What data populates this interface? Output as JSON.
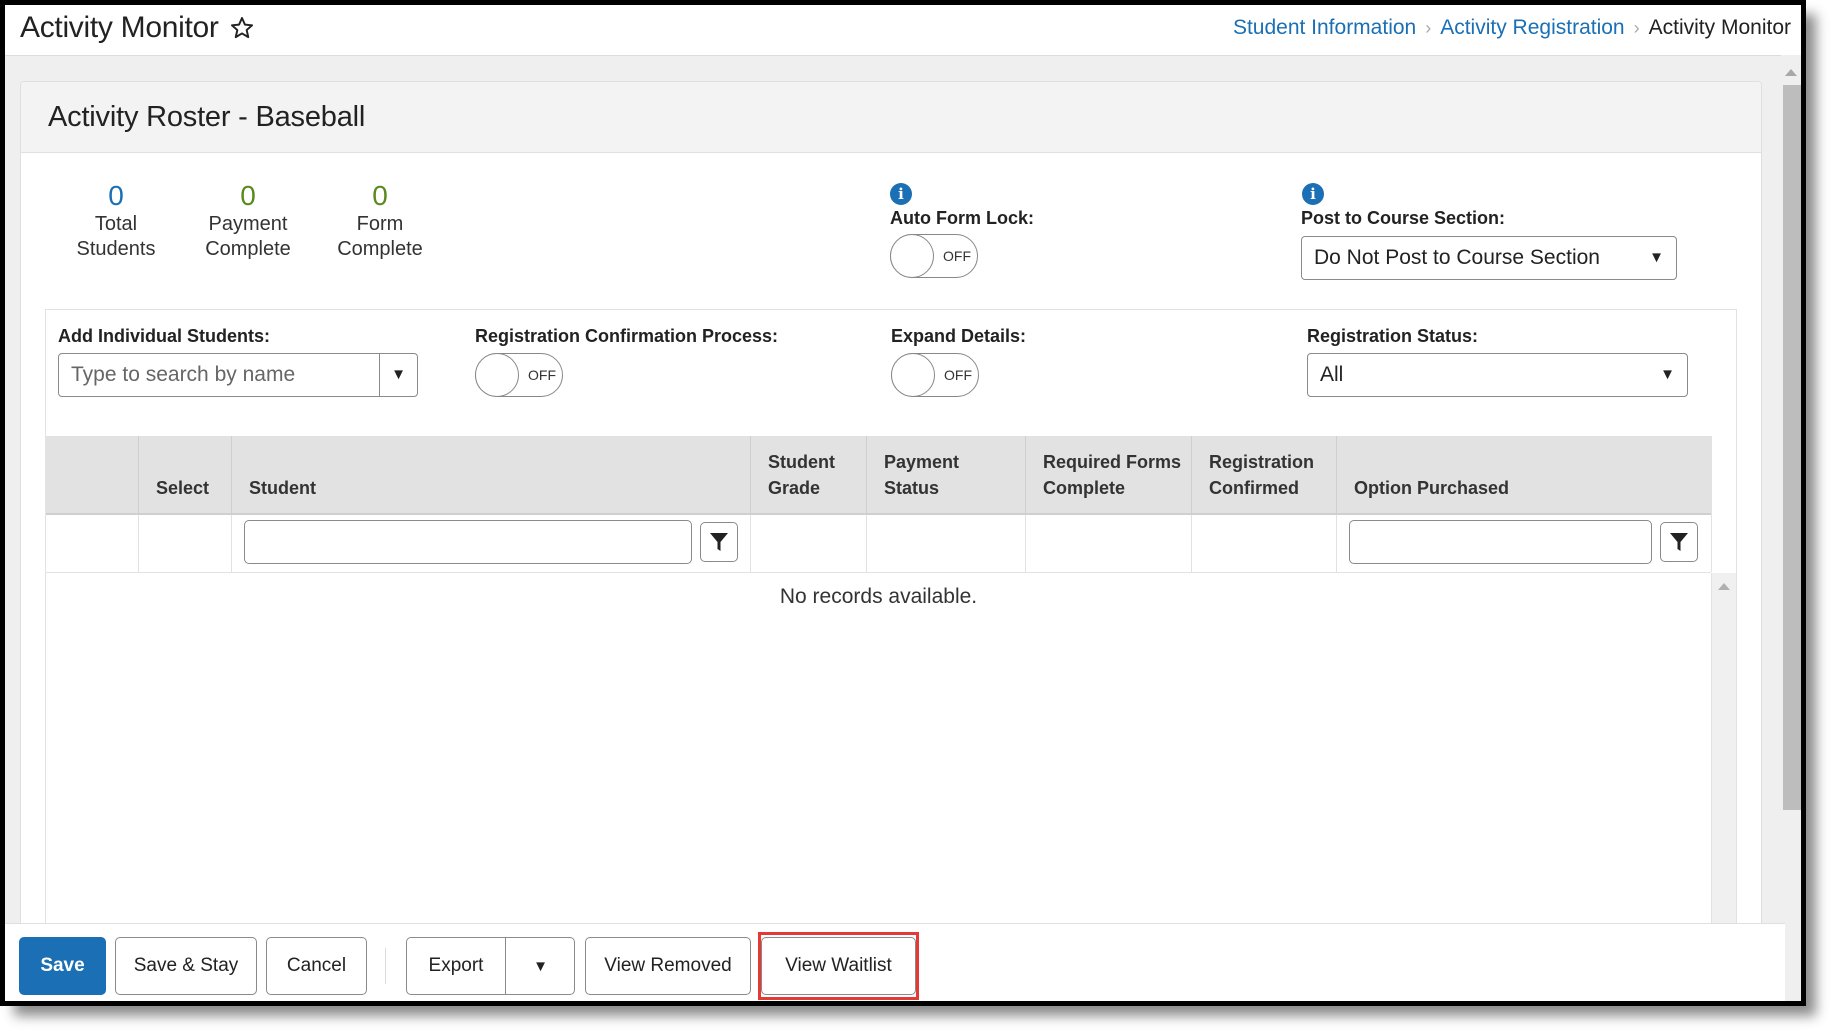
{
  "header": {
    "title": "Activity Monitor",
    "breadcrumb": [
      {
        "label": "Student Information",
        "link": true
      },
      {
        "label": "Activity Registration",
        "link": true
      },
      {
        "label": "Activity Monitor",
        "link": false
      }
    ],
    "breadcrumb_separator": "›"
  },
  "panel": {
    "title": "Activity Roster - Baseball",
    "stats": [
      {
        "value": "0",
        "label_line1": "Total",
        "label_line2": "Students",
        "color": "#1a6fb5"
      },
      {
        "value": "0",
        "label_line1": "Payment",
        "label_line2": "Complete",
        "color": "#5a8a1e"
      },
      {
        "value": "0",
        "label_line1": "Form",
        "label_line2": "Complete",
        "color": "#5a8a1e"
      }
    ],
    "auto_form_lock": {
      "label": "Auto Form Lock:",
      "state": "OFF",
      "info_icon": "i"
    },
    "post_to_course": {
      "label": "Post to Course Section:",
      "value": "Do Not Post to Course Section",
      "info_icon": "i"
    },
    "filters": {
      "add_students": {
        "label": "Add Individual Students:",
        "placeholder": "Type to search by name",
        "value": ""
      },
      "registration_confirmation": {
        "label": "Registration Confirmation Process:",
        "state": "OFF"
      },
      "expand_details": {
        "label": "Expand Details:",
        "state": "OFF"
      },
      "registration_status": {
        "label": "Registration Status:",
        "value": "All"
      }
    },
    "grid": {
      "columns": [
        {
          "line1": "",
          "line2": ""
        },
        {
          "line1": "",
          "line2": "Select"
        },
        {
          "line1": "",
          "line2": "Student"
        },
        {
          "line1": "Student",
          "line2": "Grade"
        },
        {
          "line1": "Payment",
          "line2": "Status"
        },
        {
          "line1": "Required Forms",
          "line2": "Complete"
        },
        {
          "line1": "Registration",
          "line2": "Confirmed"
        },
        {
          "line1": "",
          "line2": "Option Purchased"
        }
      ],
      "student_filter_value": "",
      "option_filter_value": "",
      "empty_message": "No records available."
    }
  },
  "actions": {
    "save": "Save",
    "save_stay": "Save & Stay",
    "cancel": "Cancel",
    "export": "Export",
    "export_menu": "▼",
    "view_removed": "View Removed",
    "view_waitlist": "View Waitlist"
  },
  "colors": {
    "accent": "#1a6fb5",
    "success": "#5a8a1e",
    "highlight": "#e53935"
  }
}
